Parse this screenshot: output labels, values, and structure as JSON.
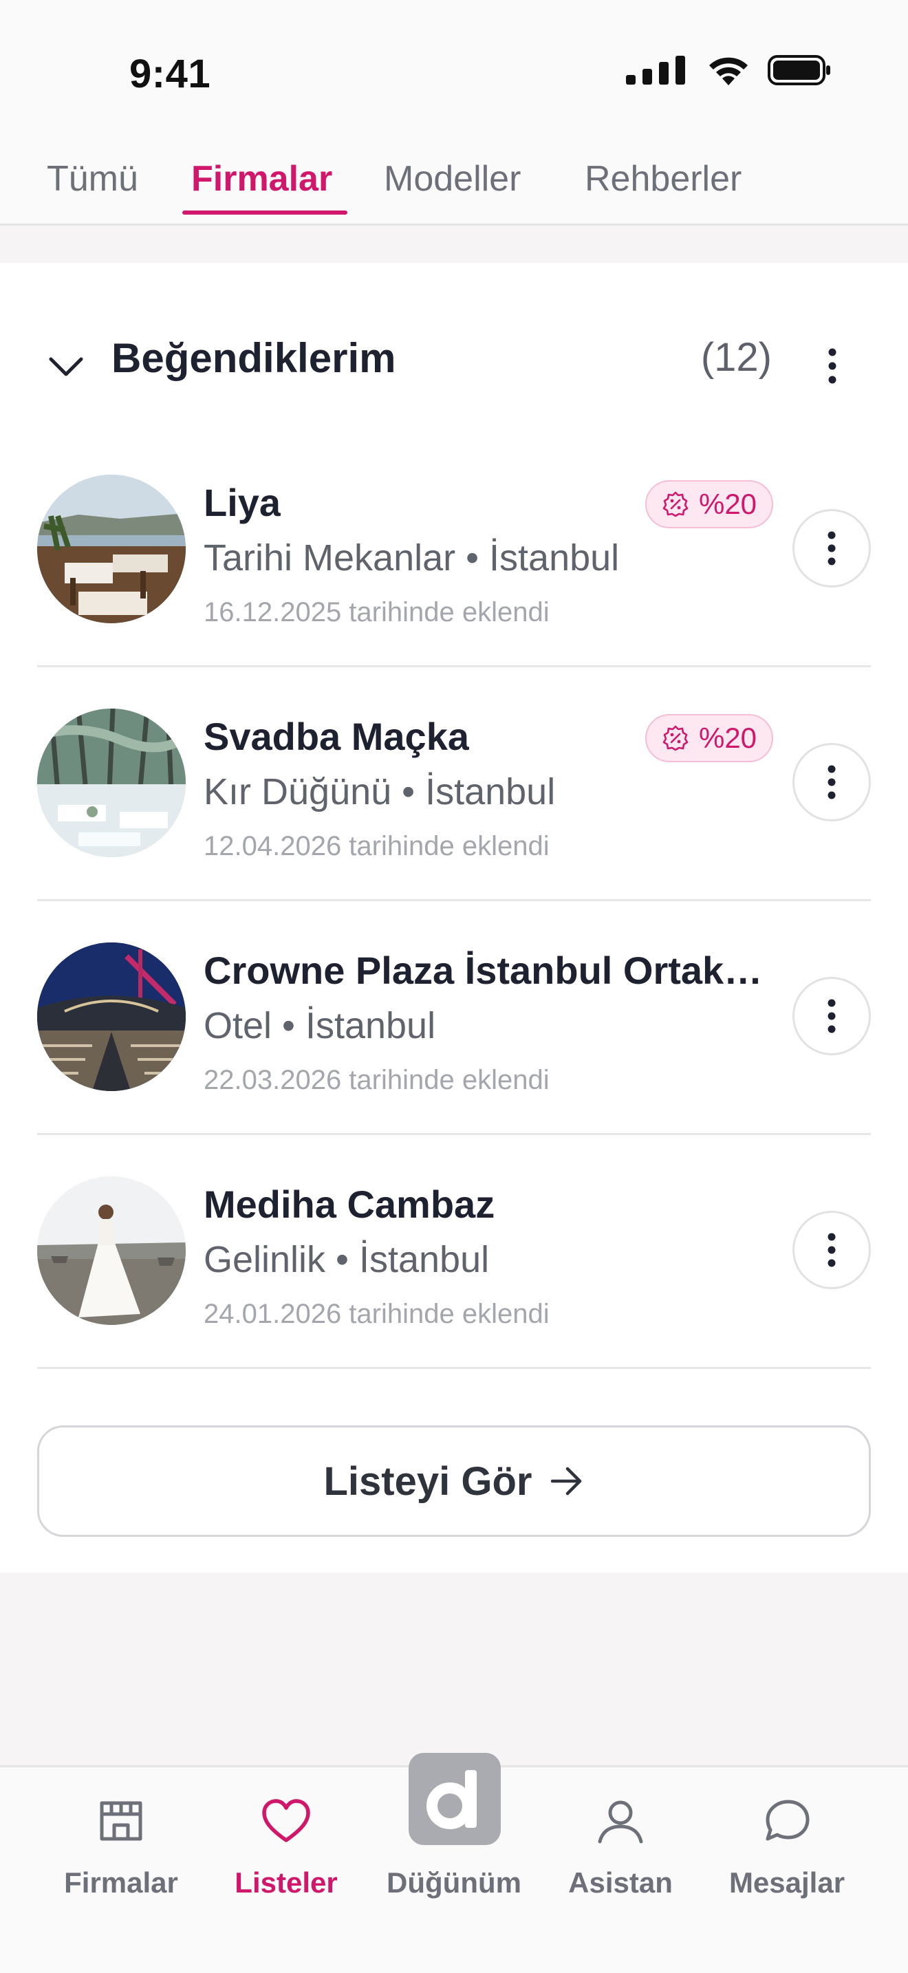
{
  "status_bar": {
    "time": "9:41"
  },
  "tabs": [
    {
      "label": "Tümü",
      "active": false
    },
    {
      "label": "Firmalar",
      "active": true
    },
    {
      "label": "Modeller",
      "active": false
    },
    {
      "label": "Rehberler",
      "active": false
    }
  ],
  "list": {
    "title": "Beğendiklerim",
    "count": "(12)",
    "items": [
      {
        "title": "Liya",
        "subtitle": "Tarihi Mekanlar • İstanbul",
        "date": "16.12.2025 tarihinde eklendi",
        "badge": "%20"
      },
      {
        "title": "Svadba Maçka",
        "subtitle": "Kır Düğünü • İstanbul",
        "date": "12.04.2026 tarihinde eklendi",
        "badge": "%20"
      },
      {
        "title": "Crowne Plaza İstanbul Ortaköy",
        "subtitle": "Otel • İstanbul",
        "date": "22.03.2026 tarihinde eklendi"
      },
      {
        "title": "Mediha Cambaz",
        "subtitle": "Gelinlik • İstanbul",
        "date": "24.01.2026 tarihinde eklendi"
      }
    ],
    "see_all_label": "Listeyi Gör"
  },
  "bottom_nav": [
    {
      "label": "Firmalar",
      "icon": "store-icon",
      "active": false
    },
    {
      "label": "Listeler",
      "icon": "heart-icon",
      "active": true
    },
    {
      "label": "Düğünüm",
      "icon": "dugun-logo-icon",
      "active": false
    },
    {
      "label": "Asistan",
      "icon": "person-icon",
      "active": false
    },
    {
      "label": "Mesajlar",
      "icon": "chat-bubble-icon",
      "active": false
    }
  ],
  "colors": {
    "accent": "#d0176b",
    "muted": "#6d7079",
    "badge_bg": "#fde8f1"
  }
}
